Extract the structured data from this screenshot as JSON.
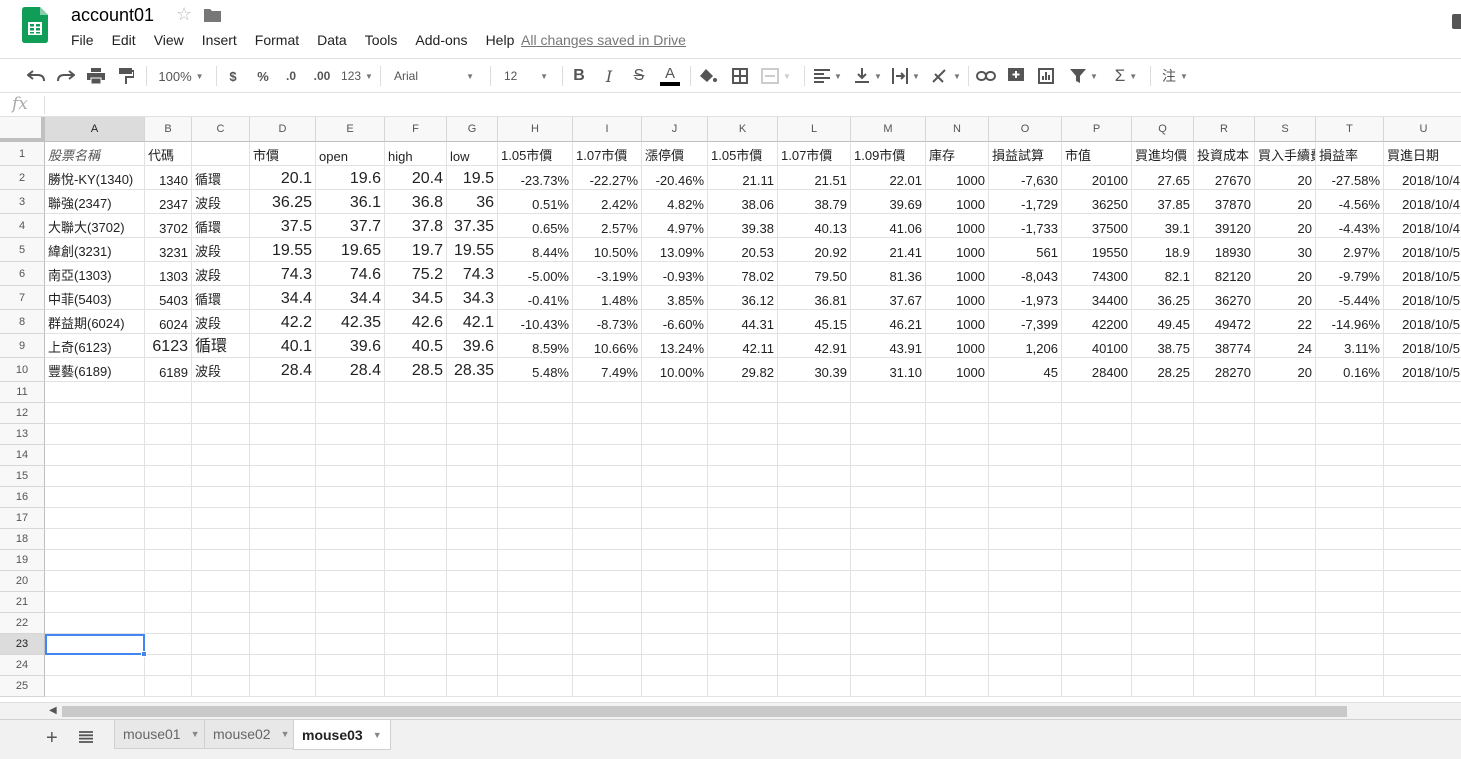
{
  "app": {
    "doc_title": "account01",
    "save_status": "All changes saved in Drive",
    "menu": [
      "File",
      "Edit",
      "View",
      "Insert",
      "Format",
      "Data",
      "Tools",
      "Add-ons",
      "Help"
    ]
  },
  "toolbar": {
    "zoom": "100%",
    "currency": "$",
    "percent": "%",
    "decrease_decimal": ".0",
    "increase_decimal": ".00",
    "more_formats": "123",
    "font": "Arial",
    "font_size": "12",
    "bold": "B",
    "italic": "I",
    "strike": "S",
    "text_color": "A",
    "input_tools": "注"
  },
  "formula": {
    "label": "fx",
    "value": ""
  },
  "sheet": {
    "columns": [
      "A",
      "B",
      "C",
      "D",
      "E",
      "F",
      "G",
      "H",
      "I",
      "J",
      "K",
      "L",
      "M",
      "N",
      "O",
      "P",
      "Q",
      "R",
      "S",
      "T",
      "U"
    ],
    "selected_column": "A",
    "selected_row": 23,
    "selected_cell": "A23",
    "row_numbers": [
      1,
      2,
      3,
      4,
      5,
      6,
      7,
      8,
      9,
      10,
      11,
      12,
      13,
      14,
      15,
      16,
      17,
      18,
      19,
      20,
      21,
      22,
      23,
      24,
      25
    ],
    "header_row": [
      "股票名稱",
      "代碼",
      "",
      "市價",
      "open",
      "high",
      "low",
      "1.05市價",
      "1.07市價",
      "漲停價",
      "1.05市價",
      "1.07市價",
      "1.09市價",
      "庫存",
      "損益試算",
      "市值",
      "買進均價",
      "投資成本",
      "買入手續費",
      "損益率",
      "買進日期"
    ],
    "rows": [
      [
        "勝悅-KY(1340)",
        "1340",
        "循環",
        "20.1",
        "19.6",
        "20.4",
        "19.5",
        "-23.73%",
        "-22.27%",
        "-20.46%",
        "21.11",
        "21.51",
        "22.01",
        "1000",
        "-7,630",
        "20100",
        "27.65",
        "27670",
        "20",
        "-27.58%",
        "2018/10/4"
      ],
      [
        "聯強(2347)",
        "2347",
        "波段",
        "36.25",
        "36.1",
        "36.8",
        "36",
        "0.51%",
        "2.42%",
        "4.82%",
        "38.06",
        "38.79",
        "39.69",
        "1000",
        "-1,729",
        "36250",
        "37.85",
        "37870",
        "20",
        "-4.56%",
        "2018/10/4"
      ],
      [
        "大聯大(3702)",
        "3702",
        "循環",
        "37.5",
        "37.7",
        "37.8",
        "37.35",
        "0.65%",
        "2.57%",
        "4.97%",
        "39.38",
        "40.13",
        "41.06",
        "1000",
        "-1,733",
        "37500",
        "39.1",
        "39120",
        "20",
        "-4.43%",
        "2018/10/4"
      ],
      [
        "緯創(3231)",
        "3231",
        "波段",
        "19.55",
        "19.65",
        "19.7",
        "19.55",
        "8.44%",
        "10.50%",
        "13.09%",
        "20.53",
        "20.92",
        "21.41",
        "1000",
        "561",
        "19550",
        "18.9",
        "18930",
        "30",
        "2.97%",
        "2018/10/5"
      ],
      [
        "南亞(1303)",
        "1303",
        "波段",
        "74.3",
        "74.6",
        "75.2",
        "74.3",
        "-5.00%",
        "-3.19%",
        "-0.93%",
        "78.02",
        "79.50",
        "81.36",
        "1000",
        "-8,043",
        "74300",
        "82.1",
        "82120",
        "20",
        "-9.79%",
        "2018/10/5"
      ],
      [
        "中菲(5403)",
        "5403",
        "循環",
        "34.4",
        "34.4",
        "34.5",
        "34.3",
        "-0.41%",
        "1.48%",
        "3.85%",
        "36.12",
        "36.81",
        "37.67",
        "1000",
        "-1,973",
        "34400",
        "36.25",
        "36270",
        "20",
        "-5.44%",
        "2018/10/5"
      ],
      [
        "群益期(6024)",
        "6024",
        "波段",
        "42.2",
        "42.35",
        "42.6",
        "42.1",
        "-10.43%",
        "-8.73%",
        "-6.60%",
        "44.31",
        "45.15",
        "46.21",
        "1000",
        "-7,399",
        "42200",
        "49.45",
        "49472",
        "22",
        "-14.96%",
        "2018/10/5"
      ],
      [
        "上奇(6123)",
        "6123",
        "循環",
        "40.1",
        "39.6",
        "40.5",
        "39.6",
        "8.59%",
        "10.66%",
        "13.24%",
        "42.11",
        "42.91",
        "43.91",
        "1000",
        "1,206",
        "40100",
        "38.75",
        "38774",
        "24",
        "3.11%",
        "2018/10/5"
      ],
      [
        "豐藝(6189)",
        "6189",
        "波段",
        "28.4",
        "28.4",
        "28.5",
        "28.35",
        "5.48%",
        "7.49%",
        "10.00%",
        "29.82",
        "30.39",
        "31.10",
        "1000",
        "45",
        "28400",
        "28.25",
        "28270",
        "20",
        "0.16%",
        "2018/10/5"
      ]
    ]
  },
  "tabs": [
    {
      "label": "mouse01",
      "active": false
    },
    {
      "label": "mouse02",
      "active": false
    },
    {
      "label": "mouse03",
      "active": true
    }
  ],
  "colors": {
    "accent": "#4285f4",
    "sheets_green": "#0f9d58"
  }
}
